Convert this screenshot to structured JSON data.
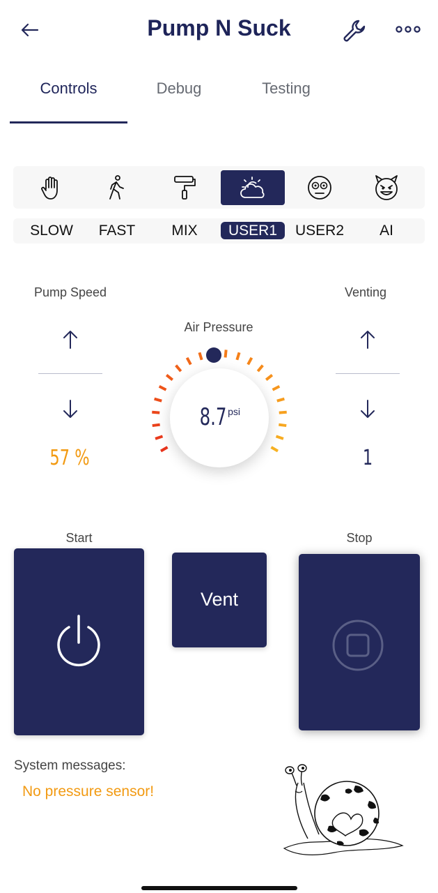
{
  "header": {
    "title": "Pump N Suck",
    "back_icon": "arrow-left-icon",
    "settings_icon": "wrench-icon",
    "more_icon": "more-horizontal-icon"
  },
  "tabs": [
    {
      "label": "Controls",
      "active": true
    },
    {
      "label": "Debug",
      "active": false
    },
    {
      "label": "Testing",
      "active": false
    }
  ],
  "modes": [
    {
      "label": "SLOW",
      "icon": "hand-icon",
      "active": false
    },
    {
      "label": "FAST",
      "icon": "walking-icon",
      "active": false
    },
    {
      "label": "MIX",
      "icon": "paint-roller-icon",
      "active": false
    },
    {
      "label": "USER1",
      "icon": "partly-cloudy-icon",
      "active": true
    },
    {
      "label": "USER2",
      "icon": "dizzy-face-icon",
      "active": false
    },
    {
      "label": "AI",
      "icon": "devil-face-icon",
      "active": false
    }
  ],
  "pump_speed": {
    "label": "Pump Speed",
    "value": "57 %"
  },
  "air_pressure": {
    "label": "Air Pressure",
    "value": "8.7",
    "unit": "psi"
  },
  "venting": {
    "label": "Venting",
    "value": "1"
  },
  "start": {
    "label": "Start"
  },
  "vent": {
    "label": "Vent"
  },
  "stop": {
    "label": "Stop"
  },
  "system": {
    "label": "System messages:",
    "message": "No pressure sensor!"
  },
  "colors": {
    "primary": "#23285a",
    "warning": "#f29a12",
    "accent_red": "#e8401c"
  }
}
